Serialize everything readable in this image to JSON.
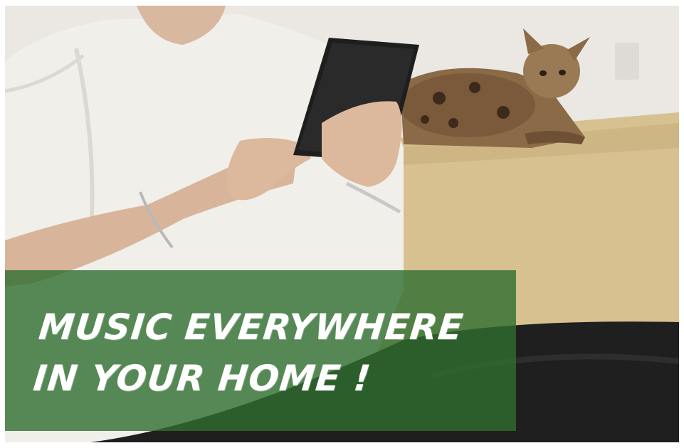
{
  "banner": {
    "line1": "MUSIC EVERYWHERE",
    "line2": "IN YOUR HOME !",
    "color": "#306e30"
  }
}
